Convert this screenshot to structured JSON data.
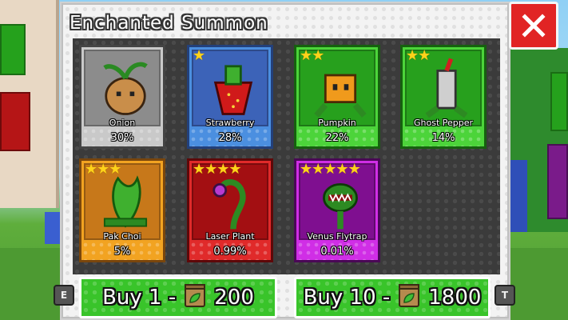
{
  "window": {
    "title": "Enchanted Summon"
  },
  "close_button": {
    "label": "X"
  },
  "cards": [
    {
      "name": "Onion",
      "chance": "30%",
      "stars": 0,
      "art_color": "#8c8c8c",
      "bar_color": "#c9c9c9",
      "border": "#444444",
      "icon": "onion-icon"
    },
    {
      "name": "Strawberry",
      "chance": "28%",
      "stars": 1,
      "art_color": "#3c63b8",
      "bar_color": "#4b8fe0",
      "border": "#23407a",
      "icon": "strawberry-icon"
    },
    {
      "name": "Pumpkin",
      "chance": "22%",
      "stars": 2,
      "art_color": "#27a01d",
      "bar_color": "#4cd43a",
      "border": "#16600f",
      "icon": "pumpkin-icon"
    },
    {
      "name": "Ghost Pepper",
      "chance": "14%",
      "stars": 2,
      "art_color": "#27a01d",
      "bar_color": "#4cd43a",
      "border": "#16600f",
      "icon": "ghost-pepper-icon"
    },
    {
      "name": "Pak Choi",
      "chance": "5%",
      "stars": 3,
      "art_color": "#c7781a",
      "bar_color": "#f2a321",
      "border": "#7a460c",
      "icon": "pak-choi-icon"
    },
    {
      "name": "Laser Plant",
      "chance": "0.99%",
      "stars": 4,
      "art_color": "#a30f12",
      "bar_color": "#e02a2a",
      "border": "#5e0809",
      "icon": "laser-plant-icon"
    },
    {
      "name": "Venus Flytrap",
      "chance": "0.01%",
      "stars": 5,
      "art_color": "#7f0f90",
      "bar_color": "#d02ee6",
      "border": "#4a0856",
      "icon": "venus-flytrap-icon"
    }
  ],
  "buy_one": {
    "label": "Buy 1 -",
    "price": "200",
    "icon": "seed-bag-icon",
    "key": "E"
  },
  "buy_ten": {
    "label": "Buy 10 -",
    "price": "1800",
    "icon": "seed-bag-icon",
    "key": "T"
  },
  "colors": {
    "accent_green": "#39c42a",
    "close_red": "#e12424",
    "star_gold": "#ffd21a"
  }
}
